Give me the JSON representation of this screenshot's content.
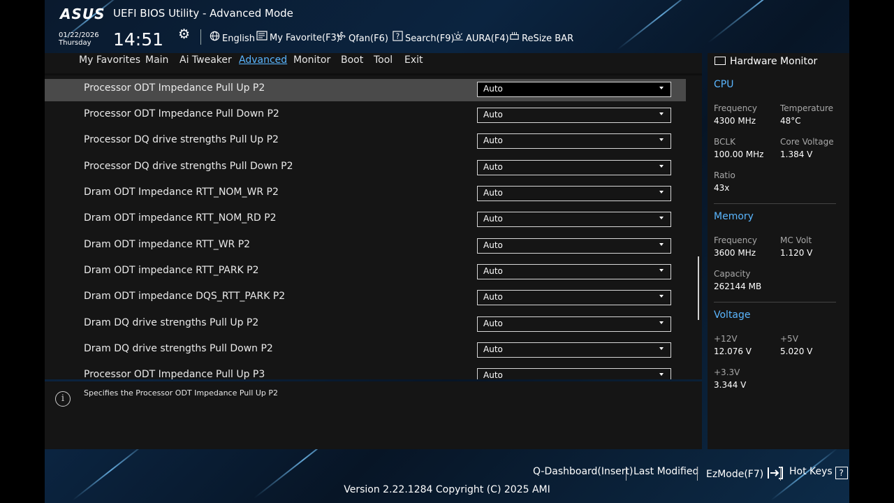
{
  "header": {
    "brand": "ASUS",
    "title": "UEFI BIOS Utility - Advanced Mode",
    "date": "01/22/2026",
    "day": "Thursday",
    "time": "14:51",
    "tools": [
      {
        "label": "English",
        "icon": "globe-icon"
      },
      {
        "label": "My Favorite(F3)",
        "icon": "favorite-icon"
      },
      {
        "label": "Qfan(F6)",
        "icon": "fan-icon"
      },
      {
        "label": "Search(F9)",
        "icon": "search-icon"
      },
      {
        "label": "AURA(F4)",
        "icon": "aura-icon"
      },
      {
        "label": "ReSize BAR",
        "icon": "resize-bar-icon"
      }
    ]
  },
  "tabs": [
    "My Favorites",
    "Main",
    "Ai Tweaker",
    "Advanced",
    "Monitor",
    "Boot",
    "Tool",
    "Exit"
  ],
  "active_tab": "Advanced",
  "settings": [
    {
      "label": "Processor ODT Impedance Pull Up P2",
      "value": "Auto"
    },
    {
      "label": "Processor ODT Impedance Pull Down P2",
      "value": "Auto"
    },
    {
      "label": "Processor DQ drive strengths Pull Up P2",
      "value": "Auto"
    },
    {
      "label": "Processor DQ drive strengths Pull Down P2",
      "value": "Auto"
    },
    {
      "label": "Dram ODT Impedance RTT_NOM_WR P2",
      "value": "Auto"
    },
    {
      "label": "Dram ODT impedance RTT_NOM_RD P2",
      "value": "Auto"
    },
    {
      "label": "Dram ODT impedance RTT_WR P2",
      "value": "Auto"
    },
    {
      "label": "Dram ODT impedance RTT_PARK P2",
      "value": "Auto"
    },
    {
      "label": "Dram ODT impedance DQS_RTT_PARK P2",
      "value": "Auto"
    },
    {
      "label": "Dram DQ drive strengths Pull Up P2",
      "value": "Auto"
    },
    {
      "label": "Dram DQ drive strengths Pull Down P2",
      "value": "Auto"
    },
    {
      "label": "Processor ODT Impedance Pull Up P3",
      "value": "Auto"
    }
  ],
  "help_text": "Specifies the Processor ODT Impedance Pull Up P2",
  "hardware_monitor": {
    "title": "Hardware Monitor",
    "cpu": {
      "heading": "CPU",
      "frequency_label": "Frequency",
      "frequency": "4300 MHz",
      "temperature_label": "Temperature",
      "temperature": "48°C",
      "bclk_label": "BCLK",
      "bclk": "100.00 MHz",
      "core_voltage_label": "Core Voltage",
      "core_voltage": "1.384 V",
      "ratio_label": "Ratio",
      "ratio": "43x"
    },
    "memory": {
      "heading": "Memory",
      "frequency_label": "Frequency",
      "frequency": "3600 MHz",
      "mc_volt_label": "MC Volt",
      "mc_volt": "1.120 V",
      "capacity_label": "Capacity",
      "capacity": "262144 MB"
    },
    "voltage": {
      "heading": "Voltage",
      "v12_label": "+12V",
      "v12": "12.076 V",
      "v5_label": "+5V",
      "v5": "5.020 V",
      "v33_label": "+3.3V",
      "v33": "3.344 V"
    }
  },
  "footer": {
    "qdashboard": "Q-Dashboard(Insert)",
    "last_modified": "Last Modified",
    "ezmode": "EzMode(F7)",
    "hotkeys": "Hot Keys",
    "hotkeys_key": "?",
    "version": "Version 2.22.1284 Copyright (C) 2025 AMI"
  },
  "colors": {
    "accent": "#5ab6ff",
    "panel": "#151515",
    "selected_row": "#4a4a4a"
  }
}
